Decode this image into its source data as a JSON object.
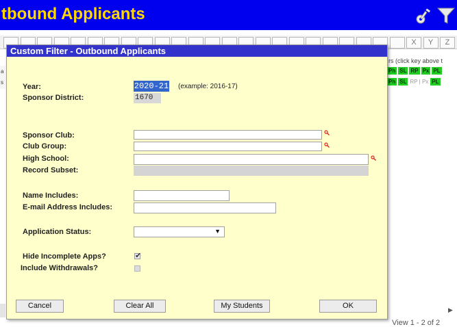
{
  "app": {
    "title": "tbound Applicants"
  },
  "alpha_bar": {
    "letters": [
      "",
      "",
      "",
      "",
      "",
      "",
      "",
      "",
      "",
      "",
      "",
      "",
      "",
      "",
      "",
      "",
      "",
      "",
      "",
      "",
      "",
      "",
      "",
      "",
      "X",
      "Y",
      "Z"
    ]
  },
  "background": {
    "column_hint": "rs (click key above t",
    "row1_tags": [
      "Ph",
      "SL",
      "RP",
      "Px",
      "PL"
    ],
    "row2_tags": [
      "Ph",
      "SL"
    ],
    "row2_inactive": "RP | Px",
    "row2_last": "PL",
    "view_count": "View 1 - 2 of 2",
    "left_row1": "a",
    "left_row2": "s"
  },
  "dialog": {
    "title": "Custom Filter - Outbound Applicants",
    "year_label": "Year:",
    "year_value": "2020-21",
    "year_example": "(example: 2016-17)",
    "district_label": "Sponsor District:",
    "district_value": "1670",
    "sponsor_club_label": "Sponsor Club:",
    "sponsor_club_value": "",
    "club_group_label": "Club Group:",
    "club_group_value": "",
    "high_school_label": "High School:",
    "high_school_value": "",
    "record_subset_label": "Record Subset:",
    "name_includes_label": "Name Includes:",
    "name_includes_value": "",
    "email_label": "E-mail Address Includes:",
    "email_value": "",
    "status_label": "Application Status:",
    "status_value": "",
    "hide_incomplete_label": "Hide Incomplete Apps?",
    "hide_incomplete_checked": true,
    "include_withdrawals_label": "Include Withdrawals?",
    "include_withdrawals_checked": false,
    "buttons": {
      "cancel": "Cancel",
      "clear_all": "Clear All",
      "my_students": "My Students",
      "ok": "OK"
    }
  },
  "colors": {
    "header_bg": "#0000ee",
    "title_text": "#ffd700",
    "dialog_bg": "#ffffcc",
    "dialog_title_bg": "#3333cc",
    "tag_green": "#22cc22"
  }
}
